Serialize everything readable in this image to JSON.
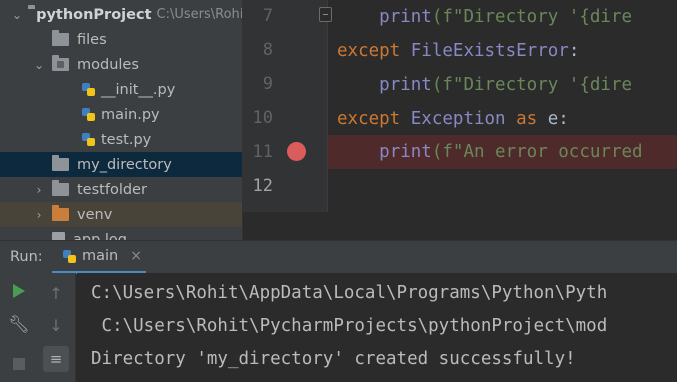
{
  "project_tree": {
    "root": {
      "name": "pythonProject",
      "path": "C:\\Users\\Rohit"
    },
    "items": [
      {
        "label": "files"
      },
      {
        "label": "modules"
      },
      {
        "label": "__init__.py"
      },
      {
        "label": "main.py"
      },
      {
        "label": "test.py"
      },
      {
        "label": "my_directory"
      },
      {
        "label": "testfolder"
      },
      {
        "label": "venv"
      },
      {
        "label": "app.log"
      }
    ]
  },
  "editor": {
    "lines": [
      {
        "num": "7",
        "parts": [
          "    ",
          "print",
          "(f\"Directory '{dire"
        ]
      },
      {
        "num": "8",
        "parts": [
          "except",
          " ",
          "FileExistsError",
          ":"
        ]
      },
      {
        "num": "9",
        "parts": [
          "    ",
          "print",
          "(f\"Directory '{dire"
        ]
      },
      {
        "num": "10",
        "parts": [
          "except",
          " ",
          "Exception",
          " ",
          "as",
          " e:"
        ]
      },
      {
        "num": "11",
        "parts": [
          "    ",
          "print",
          "(f\"An error occurred"
        ]
      },
      {
        "num": "12"
      }
    ]
  },
  "run_panel": {
    "label": "Run:",
    "tab_label": "main",
    "close_glyph": "×",
    "toolbar_icons": [
      "play-icon",
      "up-arrow-icon",
      "wrench-icon",
      "down-arrow-icon",
      "stop-icon",
      "soft-wrap-icon"
    ],
    "console_lines": [
      "C:\\Users\\Rohit\\AppData\\Local\\Programs\\Python\\Pyth",
      " C:\\Users\\Rohit\\PycharmProjects\\pythonProject\\mod",
      "Directory 'my_directory' created successfully!"
    ]
  },
  "colors": {
    "keyword": "#cc7832",
    "builtin": "#8888c6",
    "string": "#6a8759",
    "breakpoint": "#db5c5c",
    "selection": "#0d293e"
  }
}
